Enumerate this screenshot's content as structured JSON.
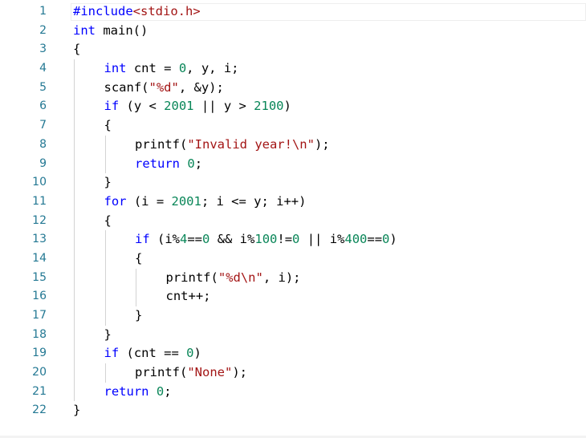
{
  "editor": {
    "colors": {
      "line_number": "#237893",
      "keyword": "#0000ff",
      "string": "#a31515",
      "number": "#098658",
      "text": "#000000",
      "indent_guide": "#d3d3d3"
    },
    "lines": [
      {
        "n": "1",
        "indent": 0,
        "tokens": [
          {
            "t": "#include",
            "c": "pp"
          },
          {
            "t": "<stdio.h>",
            "c": "str"
          }
        ]
      },
      {
        "n": "2",
        "indent": 0,
        "tokens": [
          {
            "t": "int",
            "c": "kw"
          },
          {
            "t": " main()",
            "c": ""
          }
        ]
      },
      {
        "n": "3",
        "indent": 0,
        "tokens": [
          {
            "t": "{",
            "c": ""
          }
        ]
      },
      {
        "n": "4",
        "indent": 1,
        "tokens": [
          {
            "t": "int",
            "c": "kw"
          },
          {
            "t": " cnt = ",
            "c": ""
          },
          {
            "t": "0",
            "c": "num"
          },
          {
            "t": ", y, i;",
            "c": ""
          }
        ]
      },
      {
        "n": "5",
        "indent": 1,
        "tokens": [
          {
            "t": "scanf(",
            "c": ""
          },
          {
            "t": "\"%d\"",
            "c": "str"
          },
          {
            "t": ", &y);",
            "c": ""
          }
        ]
      },
      {
        "n": "6",
        "indent": 1,
        "tokens": [
          {
            "t": "if",
            "c": "kw"
          },
          {
            "t": " (y < ",
            "c": ""
          },
          {
            "t": "2001",
            "c": "num"
          },
          {
            "t": " || y > ",
            "c": ""
          },
          {
            "t": "2100",
            "c": "num"
          },
          {
            "t": ")",
            "c": ""
          }
        ]
      },
      {
        "n": "7",
        "indent": 1,
        "tokens": [
          {
            "t": "{",
            "c": ""
          }
        ]
      },
      {
        "n": "8",
        "indent": 2,
        "tokens": [
          {
            "t": "printf(",
            "c": ""
          },
          {
            "t": "\"Invalid year!\\n\"",
            "c": "str"
          },
          {
            "t": ");",
            "c": ""
          }
        ]
      },
      {
        "n": "9",
        "indent": 2,
        "tokens": [
          {
            "t": "return",
            "c": "kw"
          },
          {
            "t": " ",
            "c": ""
          },
          {
            "t": "0",
            "c": "num"
          },
          {
            "t": ";",
            "c": ""
          }
        ]
      },
      {
        "n": "10",
        "indent": 1,
        "tokens": [
          {
            "t": "}",
            "c": ""
          }
        ]
      },
      {
        "n": "11",
        "indent": 1,
        "tokens": [
          {
            "t": "for",
            "c": "kw"
          },
          {
            "t": " (i = ",
            "c": ""
          },
          {
            "t": "2001",
            "c": "num"
          },
          {
            "t": "; i <= y; i++)",
            "c": ""
          }
        ]
      },
      {
        "n": "12",
        "indent": 1,
        "tokens": [
          {
            "t": "{",
            "c": ""
          }
        ]
      },
      {
        "n": "13",
        "indent": 2,
        "tokens": [
          {
            "t": "if",
            "c": "kw"
          },
          {
            "t": " (i%",
            "c": ""
          },
          {
            "t": "4",
            "c": "num"
          },
          {
            "t": "==",
            "c": ""
          },
          {
            "t": "0",
            "c": "num"
          },
          {
            "t": " && i%",
            "c": ""
          },
          {
            "t": "100",
            "c": "num"
          },
          {
            "t": "!=",
            "c": ""
          },
          {
            "t": "0",
            "c": "num"
          },
          {
            "t": " || i%",
            "c": ""
          },
          {
            "t": "400",
            "c": "num"
          },
          {
            "t": "==",
            "c": ""
          },
          {
            "t": "0",
            "c": "num"
          },
          {
            "t": ")",
            "c": ""
          }
        ]
      },
      {
        "n": "14",
        "indent": 2,
        "tokens": [
          {
            "t": "{",
            "c": ""
          }
        ]
      },
      {
        "n": "15",
        "indent": 3,
        "tokens": [
          {
            "t": "printf(",
            "c": ""
          },
          {
            "t": "\"%d\\n\"",
            "c": "str"
          },
          {
            "t": ", i);",
            "c": ""
          }
        ]
      },
      {
        "n": "16",
        "indent": 3,
        "tokens": [
          {
            "t": "cnt++;",
            "c": ""
          }
        ]
      },
      {
        "n": "17",
        "indent": 2,
        "tokens": [
          {
            "t": "}",
            "c": ""
          }
        ]
      },
      {
        "n": "18",
        "indent": 1,
        "tokens": [
          {
            "t": "}",
            "c": ""
          }
        ]
      },
      {
        "n": "19",
        "indent": 1,
        "tokens": [
          {
            "t": "if",
            "c": "kw"
          },
          {
            "t": " (cnt == ",
            "c": ""
          },
          {
            "t": "0",
            "c": "num"
          },
          {
            "t": ")",
            "c": ""
          }
        ]
      },
      {
        "n": "20",
        "indent": 2,
        "tokens": [
          {
            "t": "printf(",
            "c": ""
          },
          {
            "t": "\"None\"",
            "c": "str"
          },
          {
            "t": ");",
            "c": ""
          }
        ]
      },
      {
        "n": "21",
        "indent": 1,
        "tokens": [
          {
            "t": "return",
            "c": "kw"
          },
          {
            "t": " ",
            "c": ""
          },
          {
            "t": "0",
            "c": "num"
          },
          {
            "t": ";",
            "c": ""
          }
        ]
      },
      {
        "n": "22",
        "indent": 0,
        "tokens": [
          {
            "t": "}",
            "c": ""
          }
        ]
      }
    ]
  }
}
